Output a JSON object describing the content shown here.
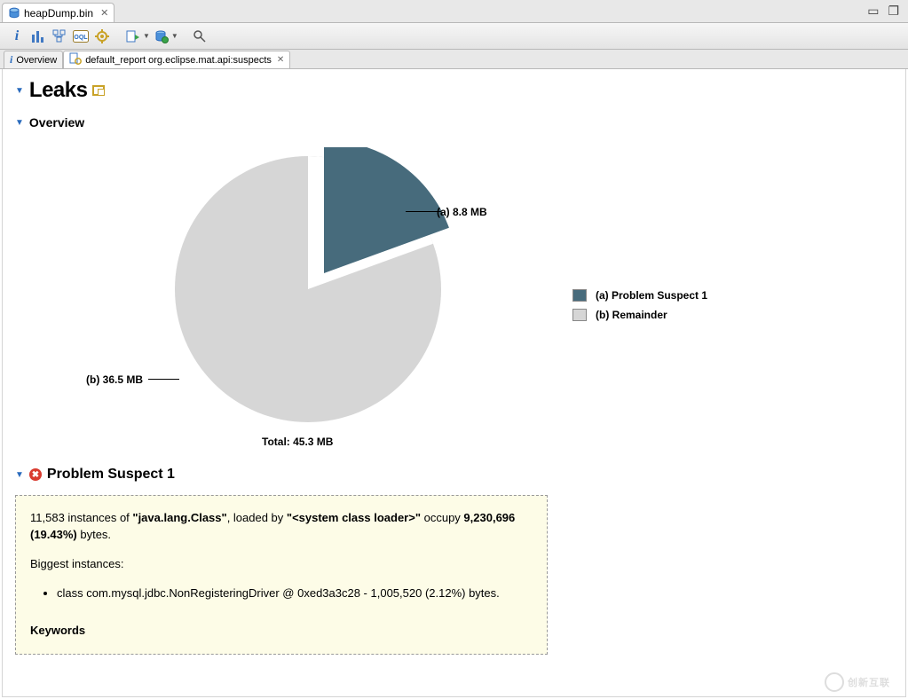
{
  "editor_tab": {
    "label": "heapDump.bin"
  },
  "inner_tabs": {
    "overview_label": "Overview",
    "report_label": "default_report  org.eclipse.mat.api:suspects"
  },
  "sections": {
    "leaks_title": "Leaks",
    "overview_title": "Overview",
    "suspect_title": "Problem Suspect 1"
  },
  "chart_data": {
    "type": "pie",
    "title": "",
    "total_label": "Total: 45.3 MB",
    "series": [
      {
        "name": "(a)  Problem Suspect 1",
        "key": "a",
        "label": "(a)  8.8 MB",
        "value_mb": 8.8,
        "color": "#476b7c"
      },
      {
        "name": "(b)  Remainder",
        "key": "b",
        "label": "(b)  36.5 MB",
        "value_mb": 36.5,
        "color": "#d6d6d6"
      }
    ]
  },
  "suspect_detail": {
    "line1_prefix": "11,583 instances of ",
    "line1_class": "\"java.lang.Class\"",
    "line1_mid": ", loaded by ",
    "line1_loader": "\"<system class loader>\"",
    "line1_suffix": " occupy ",
    "line1_bytes": "9,230,696 (19.43%)",
    "line1_tail": " bytes.",
    "biggest_label": "Biggest instances:",
    "biggest_item": "class com.mysql.jdbc.NonRegisteringDriver @ 0xed3a3c28 - 1,005,520 (2.12%) bytes.",
    "keywords_label": "Keywords"
  }
}
